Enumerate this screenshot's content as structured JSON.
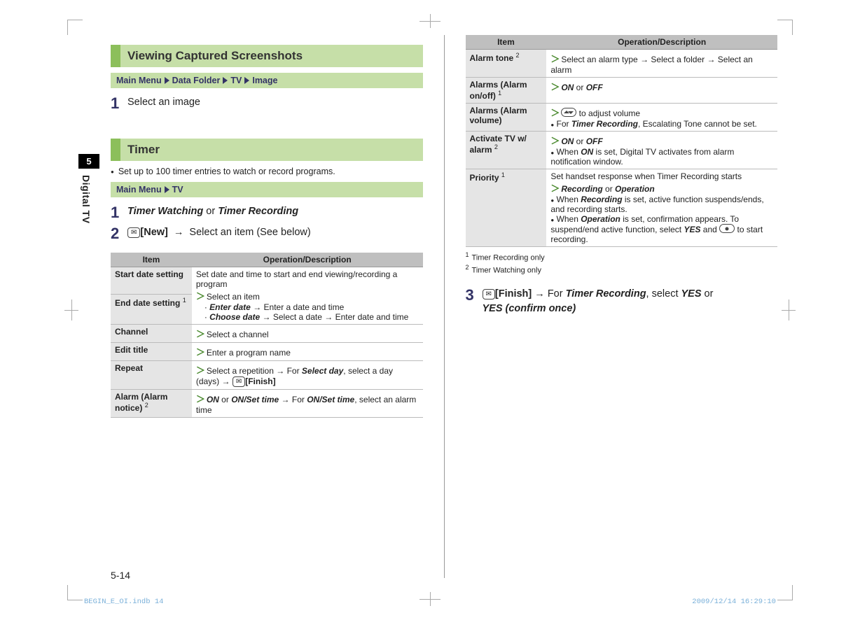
{
  "side": {
    "chapter": "5",
    "label": "Digital TV"
  },
  "page_number": "5-14",
  "footer": {
    "left": "BEGIN_E_OI.indb   14",
    "right": "2009/12/14   16:29:10"
  },
  "section1": {
    "title": "Viewing Captured Screenshots",
    "breadcrumb": [
      "Main Menu",
      "Data Folder",
      "TV",
      "Image"
    ],
    "step1_num": "1",
    "step1_text": "Select an image"
  },
  "section2": {
    "title": "Timer",
    "bullet": "Set up to 100 timer entries to watch or record programs.",
    "breadcrumb": [
      "Main Menu",
      "TV"
    ],
    "step1_num": "1",
    "step1_a": "Timer Watching",
    "step1_or": " or ",
    "step1_b": "Timer Recording",
    "step2_num": "2",
    "step2_key": "✉",
    "step2_label": "[New]",
    "step2_arrow": "→",
    "step2_text": " Select an item (See below)"
  },
  "table1": {
    "head_item": "Item",
    "head_op": "Operation/Description",
    "rows": {
      "r0_label": "Start date setting",
      "r0_text": "Set date and time to start and end viewing/recording a program",
      "r1_label_a": "End date setting",
      "r1_label_sup": "1",
      "r1_line1": "Select an item",
      "r1_sub1_b": "Enter date",
      "r1_sub1_t": " → Enter a date and time",
      "r1_sub2_b": "Choose date",
      "r1_sub2_t": " → Select a date → Enter date and time",
      "r2_label": "Channel",
      "r2_text": "Select a channel",
      "r3_label": "Edit title",
      "r3_text": "Enter a program name",
      "r4_label": "Repeat",
      "r4_t1": "Select a repetition → For ",
      "r4_b": "Select day",
      "r4_t2": ", select a day (days) → ",
      "r4_key": "✉",
      "r4_klabel": "[Finish]",
      "r5_label_a": "Alarm (Alarm notice)",
      "r5_label_sup": "2",
      "r5_b1": "ON",
      "r5_or": " or ",
      "r5_b2": "ON/Set time",
      "r5_t1": " → For ",
      "r5_b3": "ON/Set time",
      "r5_t2": ", select an alarm time"
    }
  },
  "table2": {
    "head_item": "Item",
    "head_op": "Operation/Description",
    "rows": {
      "r0_label_a": "Alarm tone",
      "r0_label_sup": "2",
      "r0_text": "Select an alarm type → Select a folder → Select an alarm",
      "r1_label_a": "Alarms (Alarm on/off)",
      "r1_label_sup": "1",
      "r1_b1": "ON",
      "r1_or": " or ",
      "r1_b2": "OFF",
      "r2_label": "Alarms (Alarm volume)",
      "r2_line1": " to adjust volume",
      "r2_bullet_pre": "For ",
      "r2_bullet_b": "Timer Recording",
      "r2_bullet_post": ", Escalating Tone cannot be set.",
      "r3_label_a": "Activate TV w/ alarm",
      "r3_label_sup": "2",
      "r3_b1": "ON",
      "r3_or": " or ",
      "r3_b2": "OFF",
      "r3_bullet_pre": "When ",
      "r3_bullet_b": "ON",
      "r3_bullet_post": " is set, Digital TV activates from alarm notification window.",
      "r4_label_a": "Priority",
      "r4_label_sup": "1",
      "r4_line1": "Set handset response when Timer Recording starts",
      "r4_b1": "Recording",
      "r4_or": " or ",
      "r4_b2": "Operation",
      "r4_bul1_pre": "When ",
      "r4_bul1_b": "Recording",
      "r4_bul1_post": " is set, active function suspends/ends, and recording starts.",
      "r4_bul2_pre": "When ",
      "r4_bul2_b": "Operation",
      "r4_bul2_mid": " is set, confirmation appears. To suspend/end active function, select ",
      "r4_bul2_yes": "YES",
      "r4_bul2_and": " and ",
      "r4_bul2_post": " to start recording."
    }
  },
  "footnotes": {
    "f1_num": "1",
    "f1_text": "Timer Recording only",
    "f2_num": "2",
    "f2_text": "Timer Watching only"
  },
  "step3": {
    "num": "3",
    "key": "✉",
    "klabel": "[Finish]",
    "arrow": " → ",
    "t1": "For ",
    "b1": "Timer Recording",
    "t2": ", select ",
    "b2": "YES",
    "t3": " or ",
    "b3": "YES (confirm once)"
  }
}
